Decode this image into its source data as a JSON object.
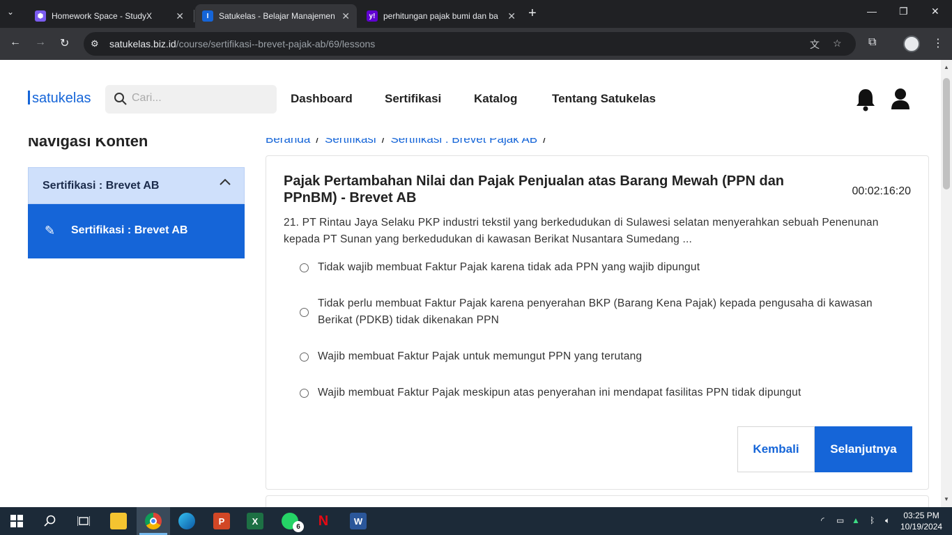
{
  "browser": {
    "tabs": [
      {
        "title": "Homework Space - StudyX",
        "favicon": "studyx-hexagon-icon",
        "active": false
      },
      {
        "title": "Satukelas - Belajar Manajemen",
        "favicon": "satukelas-icon",
        "active": true
      },
      {
        "title": "perhitungan pajak bumi dan ba",
        "favicon": "yahoo-icon",
        "active": false
      }
    ],
    "url_host": "satukelas.biz.id",
    "url_path": "/course/sertifikasi--brevet-pajak-ab/69/lessons"
  },
  "header": {
    "logo": "satukelas",
    "search_placeholder": "Cari...",
    "menu": [
      "Dashboard",
      "Sertifikasi",
      "Katalog",
      "Tentang Satukelas"
    ]
  },
  "sidebar": {
    "title": "Navigasi Konten",
    "accordion_label": "Sertifikasi : Brevet AB",
    "item_label": "Sertifikasi : Brevet AB"
  },
  "breadcrumb": [
    "Beranda",
    "Sertifikasi",
    "Sertifikasi : Brevet Pajak AB"
  ],
  "quiz": {
    "title": "Pajak Pertambahan Nilai dan Pajak Penjualan atas Barang Mewah (PPN dan PPnBM) - Brevet AB",
    "timer": "00:02:16:20",
    "question": "21. PT Rintau Jaya Selaku PKP industri tekstil yang berkedudukan di Sulawesi selatan menyerahkan sebuah Penenunan kepada PT Sunan yang berkedudukan di kawasan Berikat Nusantara Sumedang ...",
    "options": [
      "Tidak wajib membuat Faktur Pajak karena tidak ada PPN yang wajib dipungut",
      "Tidak perlu membuat Faktur Pajak karena penyerahan BKP (Barang Kena Pajak) kepada pengusaha di kawasan Berikat (PDKB) tidak dikenakan PPN",
      "Wajib membuat Faktur Pajak untuk memungut PPN yang terutang",
      "Wajib membuat Faktur Pajak meskipun atas penyerahan ini mendapat fasilitas PPN tidak dipungut"
    ],
    "back_label": "Kembali",
    "next_label": "Selanjutnya"
  },
  "taskbar": {
    "whatsapp_badge": "6",
    "time": "03:25 PM",
    "date": "10/19/2024"
  }
}
